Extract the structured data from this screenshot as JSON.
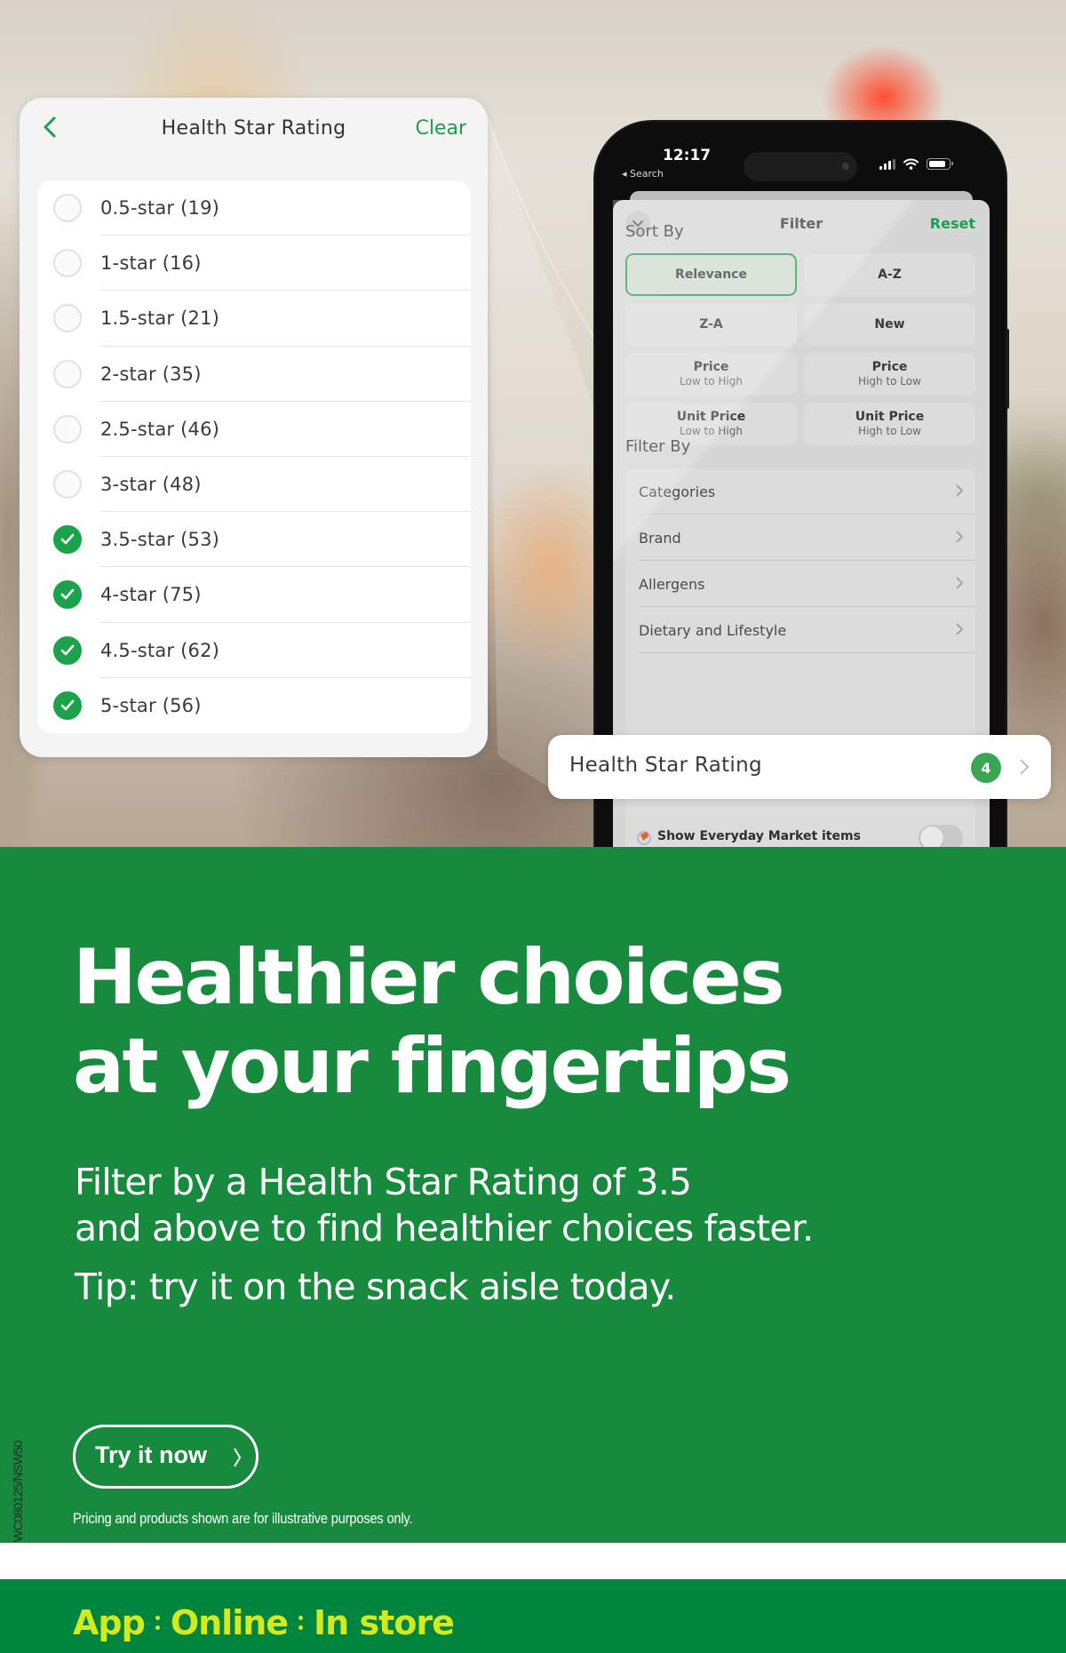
{
  "hsr_panel": {
    "back_icon": "chevron-left-icon",
    "title": "Health Star Rating",
    "clear_label": "Clear",
    "options": [
      {
        "label": "0.5-star (19)",
        "checked": false
      },
      {
        "label": "1-star (16)",
        "checked": false
      },
      {
        "label": "1.5-star (21)",
        "checked": false
      },
      {
        "label": "2-star (35)",
        "checked": false
      },
      {
        "label": "2.5-star (46)",
        "checked": false
      },
      {
        "label": "3-star (48)",
        "checked": false
      },
      {
        "label": "3.5-star (53)",
        "checked": true
      },
      {
        "label": "4-star (75)",
        "checked": true
      },
      {
        "label": "4.5-star (62)",
        "checked": true
      },
      {
        "label": "5-star (56)",
        "checked": true
      }
    ]
  },
  "phone": {
    "status": {
      "time": "12:17",
      "back_label": "◂ Search",
      "icons": [
        "signal-icon",
        "wifi-icon",
        "battery-icon"
      ]
    },
    "filter_sheet": {
      "title": "Filter",
      "reset_label": "Reset",
      "collapse_icon": "chevron-down-icon",
      "sort_by_label": "Sort By",
      "sort_options": [
        {
          "label": "Relevance",
          "sub": "",
          "active": true
        },
        {
          "label": "A-Z",
          "sub": "",
          "active": false
        },
        {
          "label": "Z-A",
          "sub": "",
          "active": false
        },
        {
          "label": "New",
          "sub": "",
          "active": false
        },
        {
          "label": "Price",
          "sub": "Low to High",
          "active": false
        },
        {
          "label": "Price",
          "sub": "High to Low",
          "active": false
        },
        {
          "label": "Unit Price",
          "sub": "Low to High",
          "active": false
        },
        {
          "label": "Unit Price",
          "sub": "High to Low",
          "active": false
        }
      ],
      "filter_by_label": "Filter By",
      "filter_options": [
        "Categories",
        "Brand",
        "Allergens",
        "Dietary and Lifestyle"
      ],
      "market_toggle": {
        "label": "Show Everyday Market items",
        "on": false
      }
    }
  },
  "callout": {
    "label": "Health Star Rating",
    "badge_count": "4"
  },
  "promo": {
    "headline_line1": "Healthier choices",
    "headline_line2": "at your fingertips",
    "body_line1": "Filter by a Health Star Rating of 3.5",
    "body_line2": "and above to find healthier choices faster.",
    "tip": "Tip: try it on the snack aisle today.",
    "cta_label": "Try it now",
    "disclaimer": "Pricing and products shown are for illustrative purposes only.",
    "code": "WC080125/NSW50"
  },
  "footer": {
    "channels": [
      "App",
      "Online",
      "In store"
    ]
  },
  "colors": {
    "brand_green": "#178a3e",
    "footer_green": "#00853f",
    "accent_lime": "#d3ea1f",
    "check_green": "#1aa34a",
    "link_green": "#1f9d4f"
  }
}
